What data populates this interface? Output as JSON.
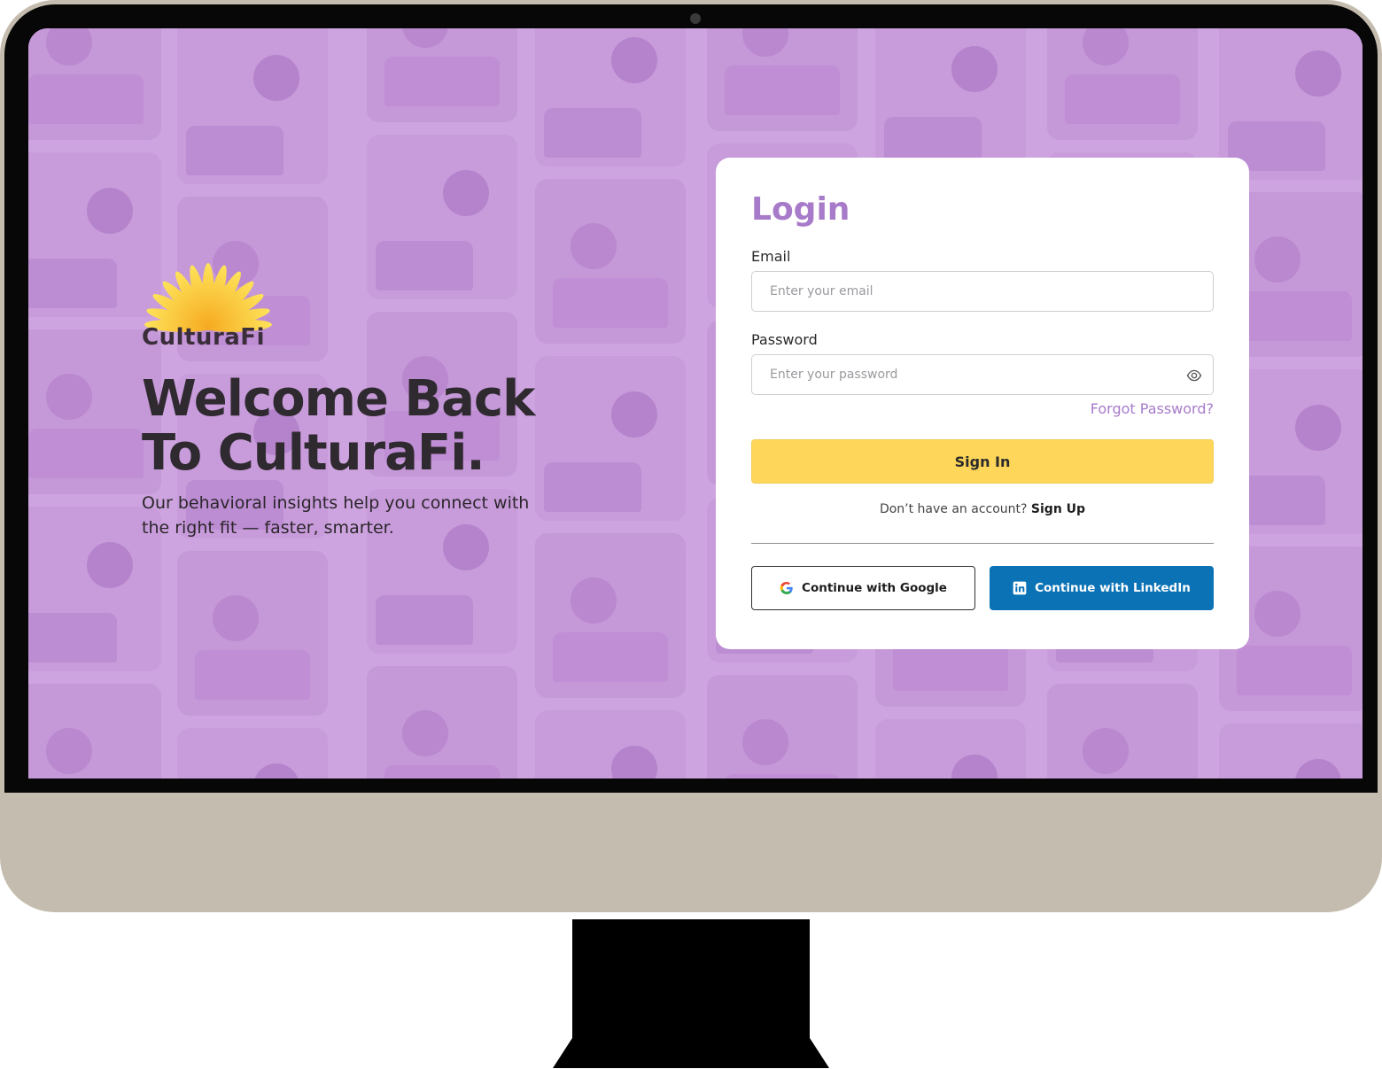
{
  "brand": {
    "name": "CulturaFi",
    "logo_colors": {
      "top": "#fde35a",
      "bottom": "#f6a81f"
    }
  },
  "hero": {
    "headline_line1": "Welcome Back",
    "headline_line2": "To CulturaFi.",
    "subtext_line1": "Our behavioral insights help you connect with",
    "subtext_line2": "the right fit — faster, smarter."
  },
  "login": {
    "title": "Login",
    "email": {
      "label": "Email",
      "placeholder": "Enter your email",
      "value": ""
    },
    "password": {
      "label": "Password",
      "placeholder": "Enter your password",
      "value": ""
    },
    "forgot_label": "Forgot Password?",
    "signin_label": "Sign In",
    "signup_prompt": "Don’t have an account?",
    "signup_label": "Sign Up",
    "google_label": "Continue with Google",
    "linkedin_label": "Continue with LinkedIn"
  },
  "colors": {
    "screen_background": "#cda3df",
    "accent_purple": "#a77bc9",
    "button_yellow": "#fed65a",
    "linkedin_blue": "#0b72b5",
    "monitor_bezel": "#070707",
    "monitor_chin": "#c4bcae"
  },
  "icons": [
    "sunburst-logo-icon",
    "eye-icon",
    "google-icon",
    "linkedin-icon"
  ]
}
